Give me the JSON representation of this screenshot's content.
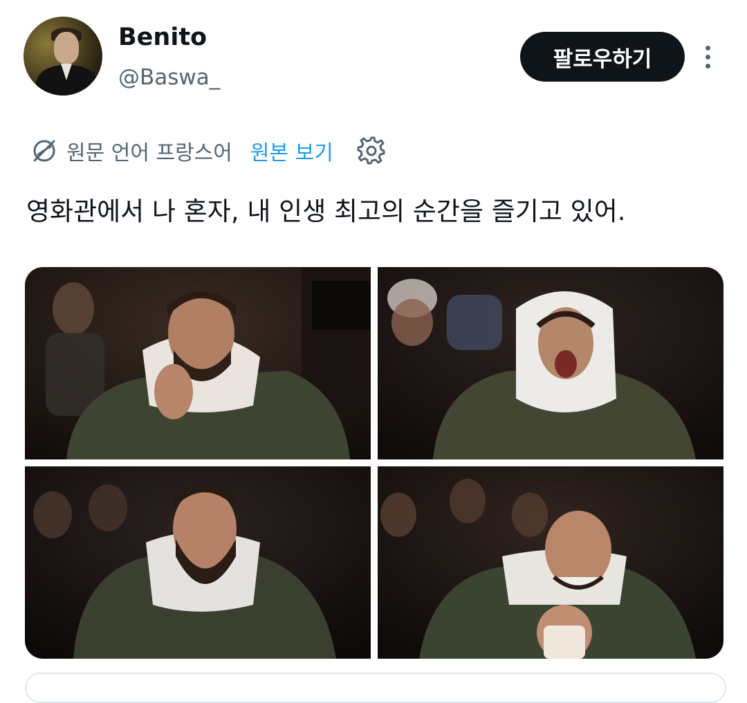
{
  "user": {
    "display_name": "Benito",
    "handle": "@Baswa_"
  },
  "actions": {
    "follow_label": "팔로우하기"
  },
  "translation": {
    "source_language": "원문 언어 프랑스어",
    "show_original_label": "원본 보기"
  },
  "tweet": {
    "text": "영화관에서 나 혼자, 내 인생 최고의 순간을 즐기고 있어."
  },
  "media": {
    "count": 4
  },
  "colors": {
    "text_primary": "#0f1419",
    "text_secondary": "#536471",
    "link_blue": "#1d9bf0",
    "button_bg": "#0f1419"
  },
  "icons": [
    "globe-icon",
    "gear-icon",
    "more-options-icon"
  ]
}
